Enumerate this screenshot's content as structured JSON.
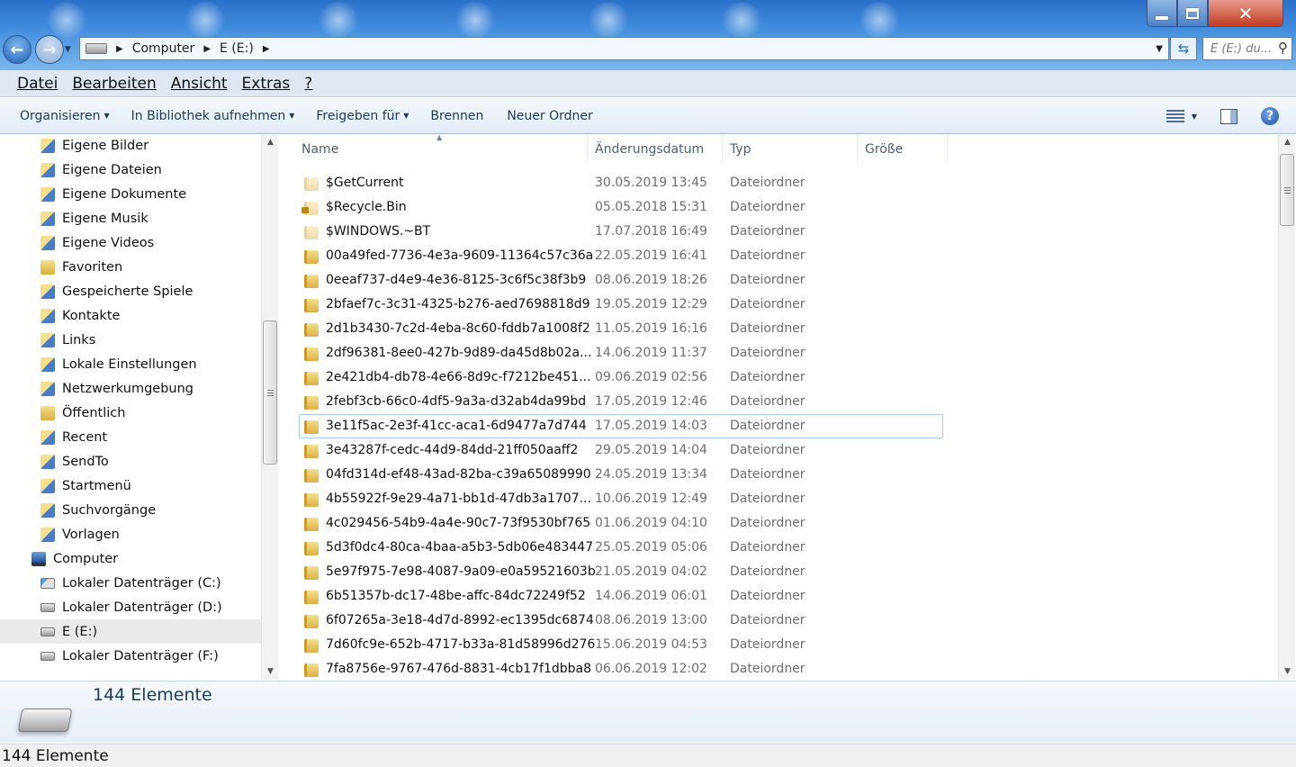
{
  "window": {
    "minimize_icon": "minimize-icon",
    "maximize_icon": "maximize-icon",
    "close_label": "✕"
  },
  "address_bar": {
    "crumbs": [
      "Computer",
      "E (E:)"
    ],
    "search_placeholder": "E (E:) du..."
  },
  "menu": {
    "items": [
      {
        "label": "Datei"
      },
      {
        "label": "Bearbeiten"
      },
      {
        "label": "Ansicht"
      },
      {
        "label": "Extras"
      },
      {
        "label": "?"
      }
    ]
  },
  "commands": {
    "organize": "Organisieren",
    "library": "In Bibliothek aufnehmen",
    "share": "Freigeben für",
    "burn": "Brennen",
    "new_folder": "Neuer Ordner"
  },
  "nav_tree": [
    {
      "label": "Eigene Bilder",
      "icon": "special-folder-icon"
    },
    {
      "label": "Eigene Dateien",
      "icon": "shortcut-folder-icon"
    },
    {
      "label": "Eigene Dokumente",
      "icon": "special-folder-icon"
    },
    {
      "label": "Eigene Musik",
      "icon": "special-folder-icon"
    },
    {
      "label": "Eigene Videos",
      "icon": "special-folder-icon"
    },
    {
      "label": "Favoriten",
      "icon": "folder-icon"
    },
    {
      "label": "Gespeicherte Spiele",
      "icon": "special-folder-icon"
    },
    {
      "label": "Kontakte",
      "icon": "special-folder-icon"
    },
    {
      "label": "Links",
      "icon": "special-folder-icon"
    },
    {
      "label": "Lokale Einstellungen",
      "icon": "shortcut-folder-icon"
    },
    {
      "label": "Netzwerkumgebung",
      "icon": "shortcut-folder-icon"
    },
    {
      "label": "Öffentlich",
      "icon": "folder-icon"
    },
    {
      "label": "Recent",
      "icon": "shortcut-folder-icon"
    },
    {
      "label": "SendTo",
      "icon": "shortcut-folder-icon"
    },
    {
      "label": "Startmenü",
      "icon": "shortcut-folder-icon"
    },
    {
      "label": "Suchvorgänge",
      "icon": "special-folder-icon"
    },
    {
      "label": "Vorlagen",
      "icon": "shortcut-folder-icon"
    },
    {
      "label": "Computer",
      "icon": "computer-icon"
    },
    {
      "label": "Lokaler Datenträger (C:)",
      "icon": "system-drive-icon"
    },
    {
      "label": "Lokaler Datenträger (D:)",
      "icon": "drive-icon"
    },
    {
      "label": "E (E:)",
      "icon": "drive-icon",
      "selected": true
    },
    {
      "label": "Lokaler Datenträger (F:)",
      "icon": "drive-icon"
    }
  ],
  "columns": [
    "Name",
    "Änderungsdatum",
    "Typ",
    "Größe"
  ],
  "files": [
    {
      "name": "$GetCurrent",
      "date": "30.05.2019 13:45",
      "type": "Dateiordner",
      "hidden": true
    },
    {
      "name": "$Recycle.Bin",
      "date": "05.05.2018 15:31",
      "type": "Dateiordner",
      "hidden": true,
      "locked": true
    },
    {
      "name": "$WINDOWS.~BT",
      "date": "17.07.2018 16:49",
      "type": "Dateiordner",
      "hidden": true
    },
    {
      "name": "00a49fed-7736-4e3a-9609-11364c57c36a",
      "date": "22.05.2019 16:41",
      "type": "Dateiordner"
    },
    {
      "name": "0eeaf737-d4e9-4e36-8125-3c6f5c38f3b9",
      "date": "08.06.2019 18:26",
      "type": "Dateiordner"
    },
    {
      "name": "2bfaef7c-3c31-4325-b276-aed7698818d9",
      "date": "19.05.2019 12:29",
      "type": "Dateiordner"
    },
    {
      "name": "2d1b3430-7c2d-4eba-8c60-fddb7a1008f2",
      "date": "11.05.2019 16:16",
      "type": "Dateiordner"
    },
    {
      "name": "2df96381-8ee0-427b-9d89-da45d8b02a...",
      "date": "14.06.2019 11:37",
      "type": "Dateiordner"
    },
    {
      "name": "2e421db4-db78-4e66-8d9c-f7212be451...",
      "date": "09.06.2019 02:56",
      "type": "Dateiordner"
    },
    {
      "name": "2febf3cb-66c0-4df5-9a3a-d32ab4da99bd",
      "date": "17.05.2019 12:46",
      "type": "Dateiordner"
    },
    {
      "name": "3e11f5ac-2e3f-41cc-aca1-6d9477a7d744",
      "date": "17.05.2019 14:03",
      "type": "Dateiordner",
      "selected": true
    },
    {
      "name": "3e43287f-cedc-44d9-84dd-21ff050aaff2",
      "date": "29.05.2019 14:04",
      "type": "Dateiordner"
    },
    {
      "name": "04fd314d-ef48-43ad-82ba-c39a65089990",
      "date": "24.05.2019 13:34",
      "type": "Dateiordner"
    },
    {
      "name": "4b55922f-9e29-4a71-bb1d-47db3a1707...",
      "date": "10.06.2019 12:49",
      "type": "Dateiordner"
    },
    {
      "name": "4c029456-54b9-4a4e-90c7-73f9530bf765",
      "date": "01.06.2019 04:10",
      "type": "Dateiordner"
    },
    {
      "name": "5d3f0dc4-80ca-4baa-a5b3-5db06e483447",
      "date": "25.05.2019 05:06",
      "type": "Dateiordner"
    },
    {
      "name": "5e97f975-7e98-4087-9a09-e0a59521603b",
      "date": "21.05.2019 04:02",
      "type": "Dateiordner"
    },
    {
      "name": "6b51357b-dc17-48be-affc-84dc72249f52",
      "date": "14.06.2019 06:01",
      "type": "Dateiordner"
    },
    {
      "name": "6f07265a-3e18-4d7d-8992-ec1395dc6874",
      "date": "08.06.2019 13:00",
      "type": "Dateiordner"
    },
    {
      "name": "7d60fc9e-652b-4717-b33a-81d58996d276",
      "date": "15.06.2019 04:53",
      "type": "Dateiordner"
    },
    {
      "name": "7fa8756e-9767-476d-8831-4cb17f1dbba8",
      "date": "06.06.2019 12:02",
      "type": "Dateiordner"
    }
  ],
  "details": {
    "count_text": "144 Elemente",
    "icon": "drive-icon"
  },
  "status": {
    "text": "144 Elemente"
  }
}
